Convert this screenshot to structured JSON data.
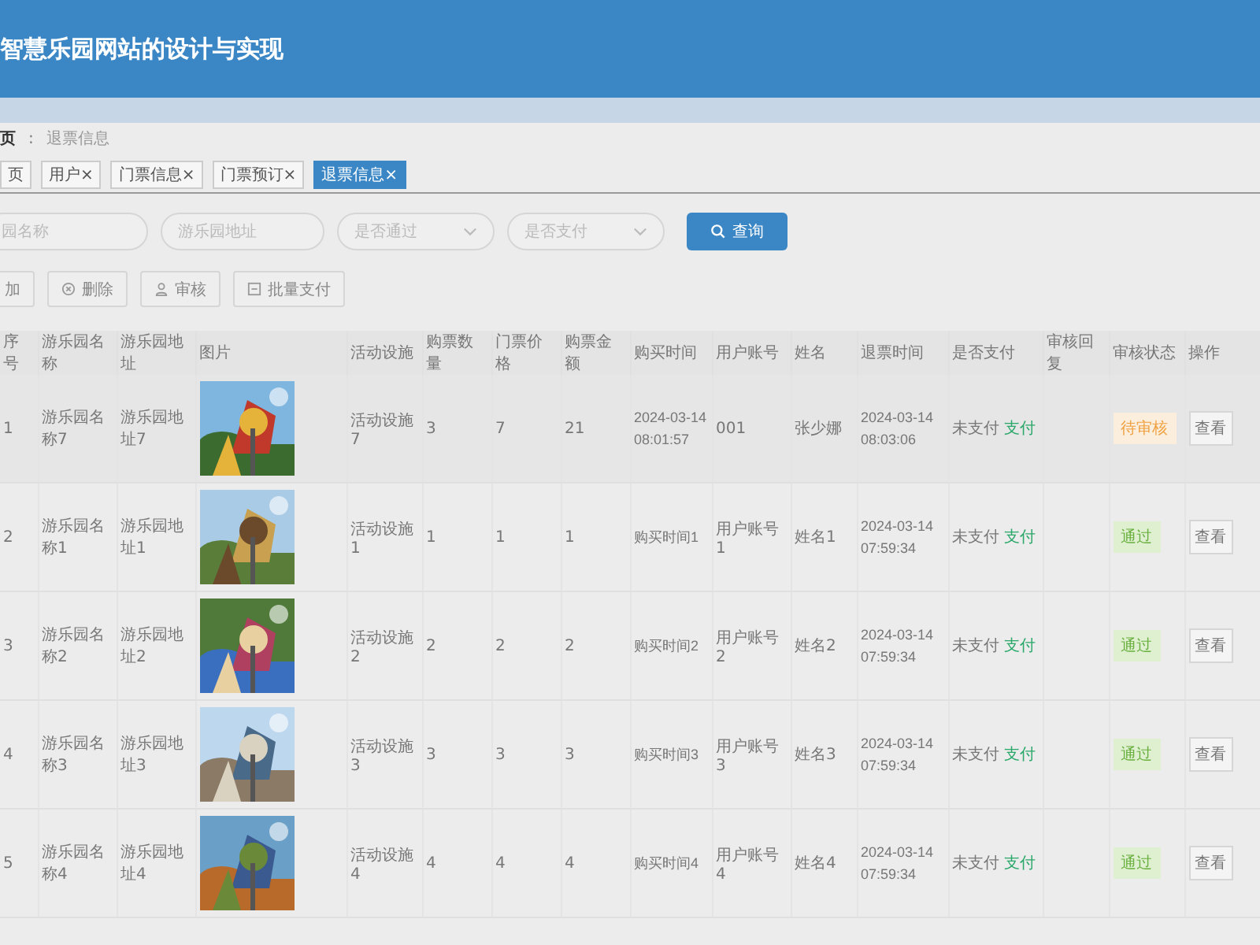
{
  "header": {
    "title": "智慧乐园网站的设计与实现"
  },
  "breadcrumb": [
    {
      "label": "页",
      "current": false
    },
    {
      "label": "退票信息",
      "current": true
    }
  ],
  "breadcrumb_separator": ":",
  "tabs": [
    {
      "label": "页",
      "selected": false
    },
    {
      "label": "用户",
      "close": "×",
      "selected": false
    },
    {
      "label": "门票信息",
      "close": "×",
      "selected": false
    },
    {
      "label": "门票预订",
      "close": "×",
      "selected": false
    },
    {
      "label": "退票信息",
      "close": "×",
      "selected": true
    }
  ],
  "filters": [
    {
      "kind": "input",
      "placeholder": "园名称"
    },
    {
      "kind": "input",
      "placeholder": "游乐园地址"
    },
    {
      "kind": "select",
      "placeholder": "是否通过"
    },
    {
      "kind": "select",
      "placeholder": "是否支付"
    }
  ],
  "search_button": "查询",
  "actions": [
    {
      "kind": "add",
      "label": "加"
    },
    {
      "kind": "delete",
      "label": "删除"
    },
    {
      "kind": "review",
      "label": "审核"
    },
    {
      "kind": "batch",
      "label": "批量支付"
    }
  ],
  "table": {
    "columns": [
      "序号",
      "游乐园名称",
      "游乐园地址",
      "图片",
      "活动设施",
      "购票数量",
      "门票价格",
      "购票金额",
      "购买时间",
      "用户账号",
      "姓名",
      "退票时间",
      "是否支付",
      "审核回复",
      "审核状态",
      "操作"
    ],
    "rows": [
      {
        "no": "1",
        "name": "游乐园名称7",
        "address": "游乐园地址7",
        "facility": "活动设施7",
        "qty": "3",
        "price": "7",
        "amount": "21",
        "buy_time": "2024-03-14 08:01:57",
        "account": "001",
        "person": "张少娜",
        "refund_time": "2024-03-14 08:03:06",
        "paid": "未支付",
        "pay_link": "支付",
        "status": {
          "kind": "pending",
          "label": "待审核"
        },
        "view": "查看"
      },
      {
        "no": "2",
        "name": "游乐园名称1",
        "address": "游乐园地址1",
        "facility": "活动设施1",
        "qty": "1",
        "price": "1",
        "amount": "1",
        "buy_time": "购买时间1",
        "account": "用户账号1",
        "person": "姓名1",
        "refund_time": "2024-03-14 07:59:34",
        "paid": "未支付",
        "pay_link": "支付",
        "status": {
          "kind": "passed",
          "label": "通过"
        },
        "view": "查看"
      },
      {
        "no": "3",
        "name": "游乐园名称2",
        "address": "游乐园地址2",
        "facility": "活动设施2",
        "qty": "2",
        "price": "2",
        "amount": "2",
        "buy_time": "购买时间2",
        "account": "用户账号2",
        "person": "姓名2",
        "refund_time": "2024-03-14 07:59:34",
        "paid": "未支付",
        "pay_link": "支付",
        "status": {
          "kind": "passed",
          "label": "通过"
        },
        "view": "查看"
      },
      {
        "no": "4",
        "name": "游乐园名称3",
        "address": "游乐园地址3",
        "facility": "活动设施3",
        "qty": "3",
        "price": "3",
        "amount": "3",
        "buy_time": "购买时间3",
        "account": "用户账号3",
        "person": "姓名3",
        "refund_time": "2024-03-14 07:59:34",
        "paid": "未支付",
        "pay_link": "支付",
        "status": {
          "kind": "passed",
          "label": "通过"
        },
        "view": "查看"
      },
      {
        "no": "5",
        "name": "游乐园名称4",
        "address": "游乐园地址4",
        "facility": "活动设施4",
        "qty": "4",
        "price": "4",
        "amount": "4",
        "buy_time": "购买时间4",
        "account": "用户账号4",
        "person": "姓名4",
        "refund_time": "2024-03-14 07:59:34",
        "paid": "未支付",
        "pay_link": "支付",
        "status": {
          "kind": "passed",
          "label": "通过"
        },
        "view": "查看"
      }
    ]
  }
}
